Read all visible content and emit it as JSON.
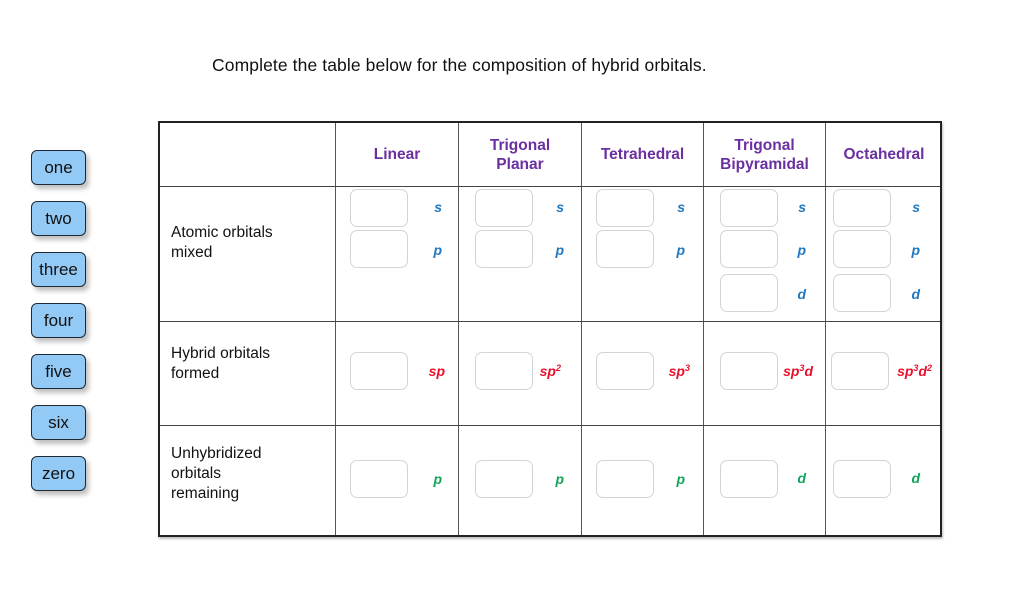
{
  "instruction": "Complete the table below for the composition of hybrid orbitals.",
  "word_bank": [
    "one",
    "two",
    "three",
    "four",
    "five",
    "six",
    "zero"
  ],
  "table": {
    "columns": [
      "Linear",
      "Trigonal Planar",
      "Tetrahedral",
      "Trigonal Bipyramidal",
      "Octahedral"
    ],
    "column_lines": [
      [
        "Linear"
      ],
      [
        "Trigonal",
        "Planar"
      ],
      [
        "Tetrahedral"
      ],
      [
        "Trigonal",
        "Bipyramidal"
      ],
      [
        "Octahedral"
      ]
    ],
    "rows": [
      {
        "label_lines": [
          "Atomic orbitals",
          "mixed"
        ],
        "cells": [
          [
            {
              "orbital": "s",
              "value": ""
            },
            {
              "orbital": "p",
              "value": ""
            }
          ],
          [
            {
              "orbital": "s",
              "value": ""
            },
            {
              "orbital": "p",
              "value": ""
            }
          ],
          [
            {
              "orbital": "s",
              "value": ""
            },
            {
              "orbital": "p",
              "value": ""
            }
          ],
          [
            {
              "orbital": "s",
              "value": ""
            },
            {
              "orbital": "p",
              "value": ""
            },
            {
              "orbital": "d",
              "value": ""
            }
          ],
          [
            {
              "orbital": "s",
              "value": ""
            },
            {
              "orbital": "p",
              "value": ""
            },
            {
              "orbital": "d",
              "value": ""
            }
          ]
        ]
      },
      {
        "label_lines": [
          "Hybrid orbitals",
          "formed"
        ],
        "cells": [
          [
            {
              "orbital": "sp",
              "base": "sp",
              "sup": "",
              "tail": "",
              "value": ""
            }
          ],
          [
            {
              "orbital": "sp2",
              "base": "sp",
              "sup": "2",
              "tail": "",
              "value": ""
            }
          ],
          [
            {
              "orbital": "sp3",
              "base": "sp",
              "sup": "3",
              "tail": "",
              "value": ""
            }
          ],
          [
            {
              "orbital": "sp3d",
              "base": "sp",
              "sup": "3",
              "tail": "d",
              "value": ""
            }
          ],
          [
            {
              "orbital": "sp3d2",
              "base": "sp",
              "sup": "3",
              "tail": "d",
              "sup2": "2",
              "value": ""
            }
          ]
        ]
      },
      {
        "label_lines": [
          "Unhybridized",
          "orbitals",
          "remaining"
        ],
        "cells": [
          [
            {
              "orbital": "p",
              "value": ""
            }
          ],
          [
            {
              "orbital": "p",
              "value": ""
            }
          ],
          [
            {
              "orbital": "p",
              "value": ""
            }
          ],
          [
            {
              "orbital": "d",
              "value": ""
            }
          ],
          [
            {
              "orbital": "d",
              "value": ""
            }
          ]
        ]
      }
    ]
  },
  "colors": {
    "header_text": "#6a2fa0",
    "atomic_orbital_label": "#1f78c1",
    "hybrid_label": "#e8112d",
    "unhybridized_label": "#12a35a",
    "chip_fill": "#93c9f5"
  }
}
